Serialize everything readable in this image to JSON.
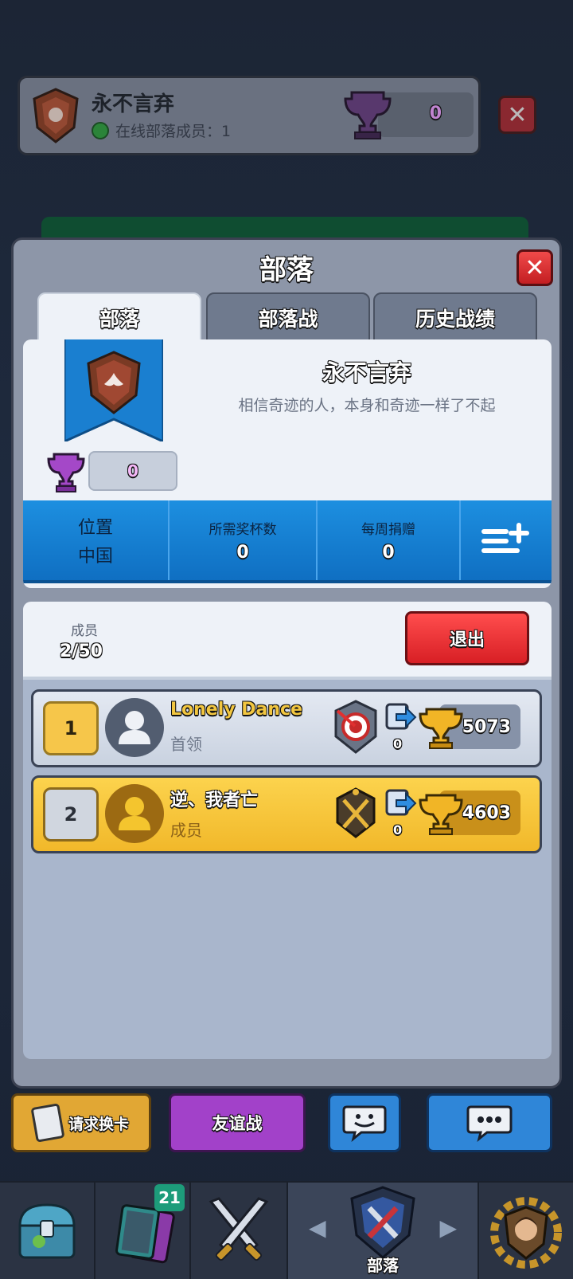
{
  "background_header": {
    "clan_name": "永不言弃",
    "online_text": "在线部落成员：1",
    "trophies": "0"
  },
  "panel": {
    "title": "部落",
    "tabs": [
      "部落",
      "部落战",
      "历史战绩"
    ],
    "clan": {
      "name": "永不言弃",
      "description": "相信奇迹的人，本身和奇迹一样了不起",
      "trophies": "0"
    },
    "stats": [
      {
        "label": "位置",
        "value": "中国"
      },
      {
        "label": "所需奖杯数",
        "value": "0"
      },
      {
        "label": "每周捐赠",
        "value": "0"
      }
    ],
    "members_label": "成员",
    "members_count": "2/50",
    "leave_label": "退出",
    "members": [
      {
        "rank": "1",
        "name": "Lonely Dance",
        "role": "首领",
        "donations": "0",
        "trophies": "5073"
      },
      {
        "rank": "2",
        "name": "逆、我者亡",
        "role": "成员",
        "donations": "0",
        "trophies": "4603"
      }
    ]
  },
  "actions": {
    "request_cards": "请求换卡",
    "friendly_battle": "友谊战"
  },
  "nav": {
    "cards_badge": "21",
    "clan_label": "部落"
  },
  "colors": {
    "accent_blue": "#1d8fe0",
    "leave_red": "#e02a2f",
    "gold": "#f6c64a"
  }
}
